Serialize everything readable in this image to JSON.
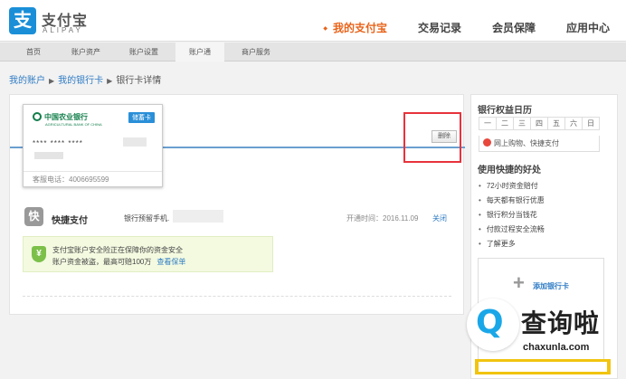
{
  "header": {
    "logo_icon": "支",
    "logo_cn": "支付宝",
    "logo_en": "ALIPAY",
    "nav": [
      "我的支付宝",
      "交易记录",
      "会员保障",
      "应用中心"
    ],
    "accent_color": "#e8641b"
  },
  "subnav": [
    "首页",
    "账户资产",
    "账户设置",
    "账户通",
    "商户服务"
  ],
  "breadcrumb": [
    "我的账户",
    "我的银行卡",
    "银行卡详情"
  ],
  "card": {
    "bank_name": "中国农业银行",
    "bank_name_en": "AGRICULTURAL BANK OF CHINA",
    "type_badge": "储蓄卡",
    "number": "**** **** ****",
    "phone": "客服电话：4006695599"
  },
  "delete_label": "删除",
  "quick_pay": {
    "icon": "快",
    "title": "快捷支付",
    "phone_label": "银行预留手机.",
    "open_time": "开通时间：2016.11.09",
    "close_label": "关闭"
  },
  "safety": {
    "icon": "¥",
    "line1": "支付宝账户安全险正在保障你的资金安全",
    "line2": "账户资金被盗，最高可赔100万",
    "link": "查看保单"
  },
  "sidebar": {
    "calendar_title": "银行权益日历",
    "weekdays": [
      "一",
      "二",
      "三",
      "四",
      "五",
      "六",
      "日"
    ],
    "calendar_item": "网上购物、快捷支付",
    "benefits_title": "使用快捷的好处",
    "benefits": [
      "72小时资金赔付",
      "每天都有银行优惠",
      "银行积分当钱花",
      "付款过程安全流畅",
      "了解更多"
    ],
    "add_card": "添加银行卡"
  },
  "watermark": {
    "cn": "查询啦",
    "en": "chaxunla.com"
  }
}
